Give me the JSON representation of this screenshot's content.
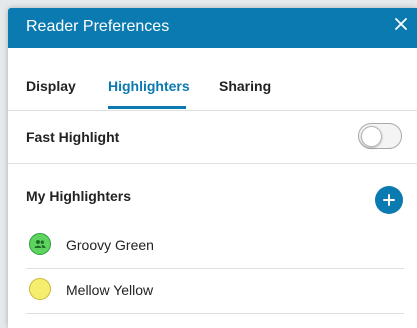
{
  "dialog": {
    "title": "Reader Preferences",
    "header_color": "#0a7ab0",
    "close_icon": "close-icon"
  },
  "tabs": [
    {
      "label": "Display",
      "active": false
    },
    {
      "label": "Highlighters",
      "active": true
    },
    {
      "label": "Sharing",
      "active": false
    }
  ],
  "fast_highlight": {
    "label": "Fast Highlight",
    "enabled": false
  },
  "my_highlighters": {
    "title": "My Highlighters",
    "add_icon": "plus-icon",
    "items": [
      {
        "name": "Groovy Green",
        "color": "#5fd35f",
        "border": "#2f9e3a",
        "shared_icon": "people-icon"
      },
      {
        "name": "Mellow Yellow",
        "color": "#f3ee6e",
        "border": "#c9b838"
      }
    ]
  }
}
